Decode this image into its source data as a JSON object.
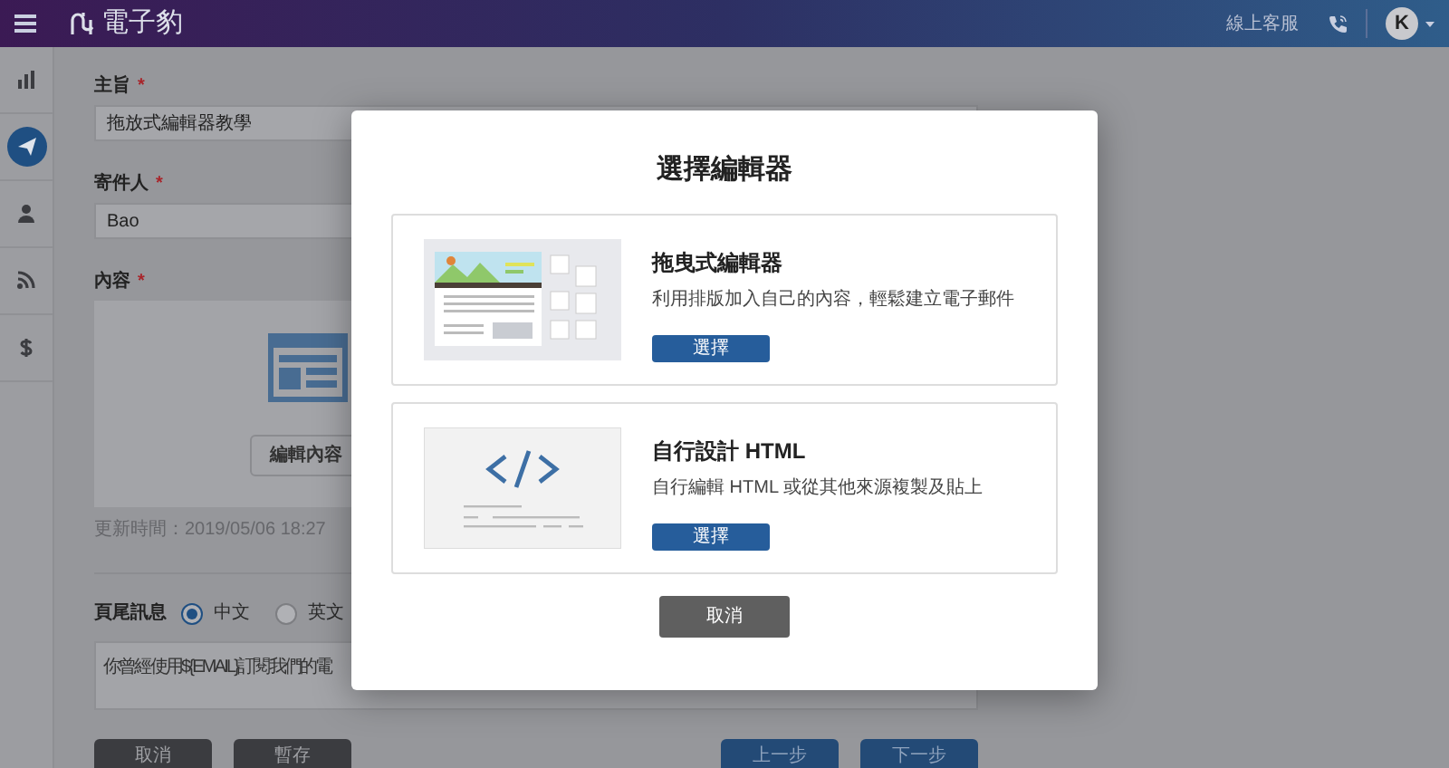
{
  "navbar": {
    "brand": "電子豹",
    "support": "線上客服",
    "avatar": "K"
  },
  "sidebar": {
    "items": [
      {
        "selected": false
      },
      {
        "selected": true
      },
      {
        "selected": false
      },
      {
        "selected": false
      },
      {
        "selected": false
      }
    ]
  },
  "form": {
    "subject": {
      "label": "主旨",
      "required_mark": "*",
      "value": "拖放式編輯器教學"
    },
    "sender": {
      "label": "寄件人",
      "required_mark": "*",
      "value": "Bao"
    },
    "content": {
      "label": "內容",
      "required_mark": "*",
      "button": "編輯內容",
      "updated": "更新時間：2019/05/06 18:27"
    },
    "footer": {
      "label": "頁尾訊息",
      "options": [
        {
          "label": "中文",
          "selected": true
        },
        {
          "label": "英文",
          "selected": false
        }
      ],
      "text": "你曾經使用${EMAIL}訂閱我們的電"
    },
    "buttons": [
      {
        "label": "取消",
        "kind": "dark"
      },
      {
        "label": "暫存",
        "kind": "dark"
      },
      {
        "label": "上一步",
        "kind": "primary"
      },
      {
        "label": "下一步",
        "kind": "primary"
      }
    ]
  },
  "modal": {
    "title": "選擇編輯器",
    "options": [
      {
        "kind": "drag",
        "title": "拖曳式編輯器",
        "description": "利用排版加入自己的內容，輕鬆建立電子郵件",
        "button": "選擇"
      },
      {
        "kind": "html",
        "title": "自行設計 HTML",
        "description": "自行編輯 HTML 或從其他來源複製及貼上",
        "button": "選擇"
      }
    ],
    "cancel": "取消"
  }
}
